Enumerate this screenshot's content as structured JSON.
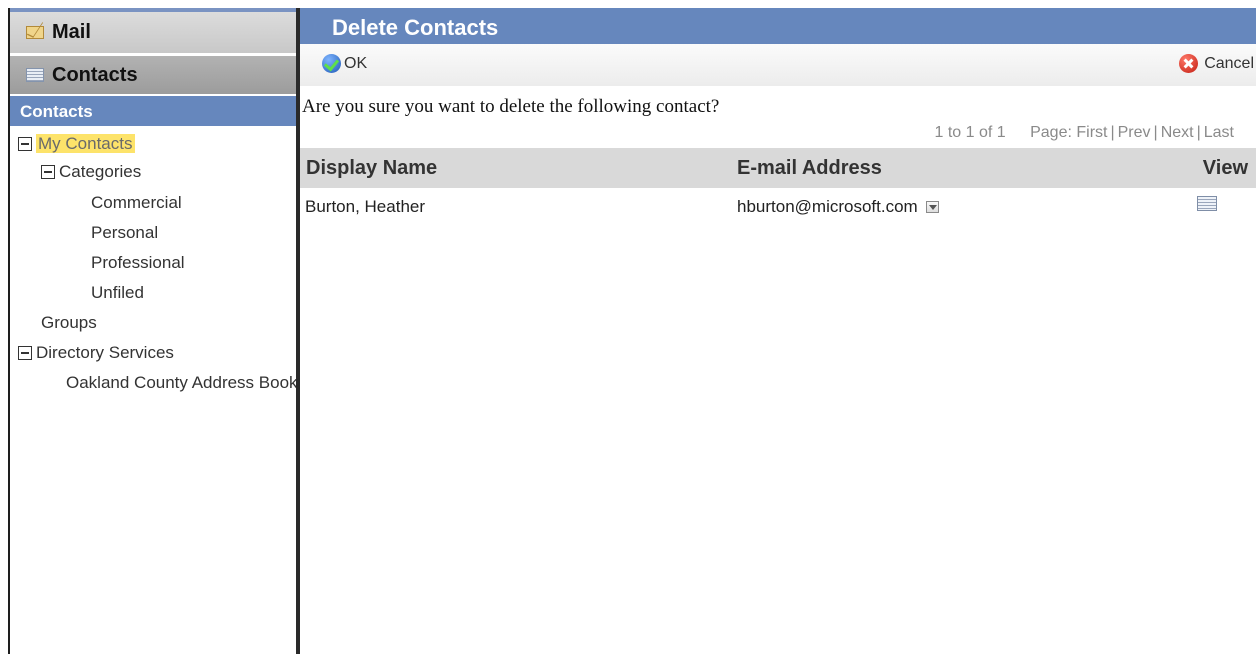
{
  "nav": {
    "mail_label": "Mail",
    "contacts_label": "Contacts"
  },
  "sidebar": {
    "section_title": "Contacts",
    "tree": {
      "my_contacts": "My Contacts",
      "categories": "Categories",
      "category_items": [
        "Commercial",
        "Personal",
        "Professional",
        "Unfiled"
      ],
      "groups": "Groups",
      "directory_services": "Directory Services",
      "address_book": "Oakland County Address Book"
    }
  },
  "dialog": {
    "title": "Delete Contacts",
    "ok_label": "OK",
    "cancel_label": "Cancel",
    "message": "Are you sure you want to delete the following contact?"
  },
  "pager": {
    "count": "1 to 1 of 1",
    "page_label": "Page:",
    "first": "First",
    "prev": "Prev",
    "next": "Next",
    "last": "Last"
  },
  "table": {
    "columns": [
      "Display Name",
      "E-mail Address",
      "View"
    ],
    "rows": [
      {
        "display_name": "Burton, Heather",
        "email": "hburton@microsoft.com"
      }
    ]
  },
  "colors": {
    "header_blue": "#6687bd",
    "selection_yellow": "#fde36a",
    "table_header_gray": "#d9d9d9"
  },
  "icons": [
    "mail-icon",
    "contact-card-icon",
    "ok-check-icon",
    "cancel-x-icon",
    "dropdown-arrow-icon",
    "view-card-icon",
    "tree-collapse-icon"
  ]
}
